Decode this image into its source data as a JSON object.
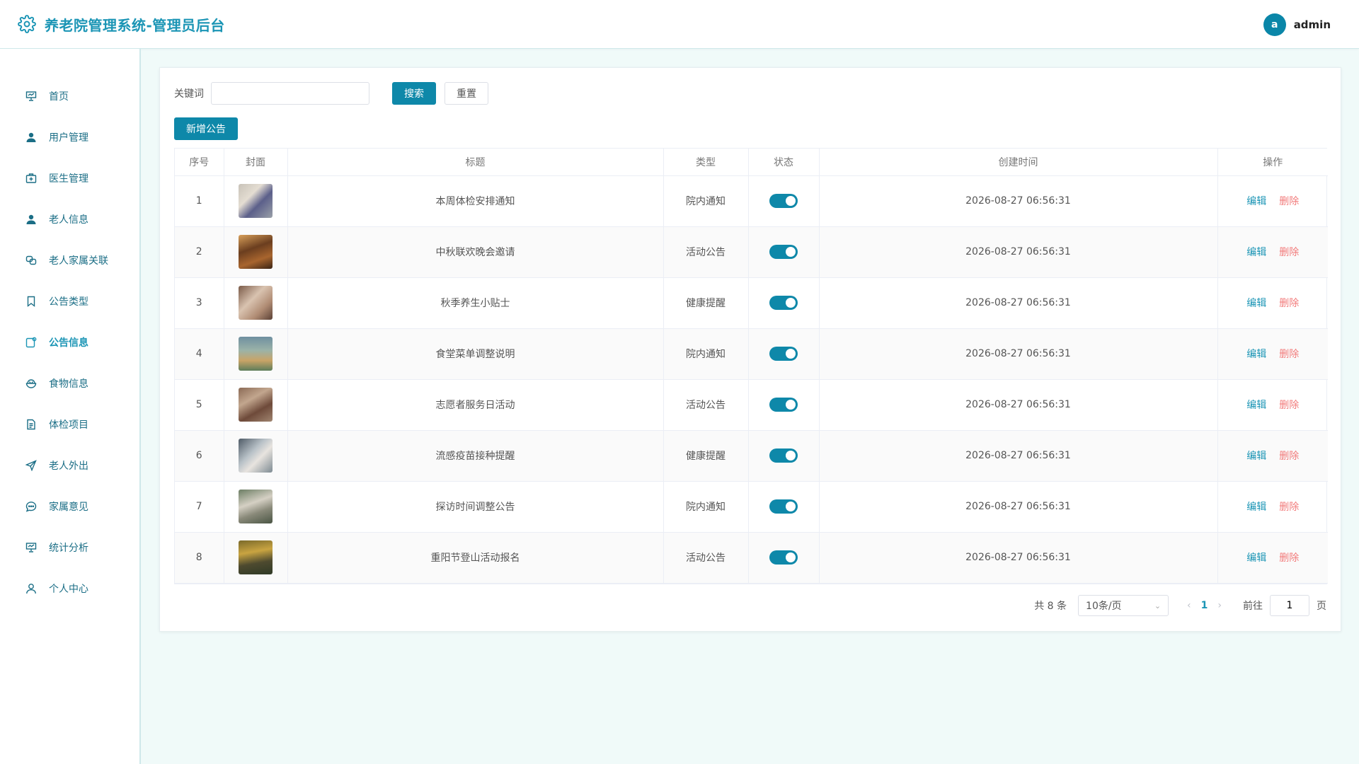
{
  "header": {
    "title": "养老院管理系统-管理员后台",
    "avatar_letter": "a",
    "username": "admin"
  },
  "sidebar": {
    "items": [
      {
        "label": "首页",
        "icon": "presentation-board-icon"
      },
      {
        "label": "用户管理",
        "icon": "user-icon"
      },
      {
        "label": "医生管理",
        "icon": "medical-kit-icon"
      },
      {
        "label": "老人信息",
        "icon": "user-icon"
      },
      {
        "label": "老人家属关联",
        "icon": "link-icon"
      },
      {
        "label": "公告类型",
        "icon": "bookmark-icon"
      },
      {
        "label": "公告信息",
        "icon": "notice-icon",
        "active": true
      },
      {
        "label": "食物信息",
        "icon": "food-bowl-icon"
      },
      {
        "label": "体检项目",
        "icon": "document-icon"
      },
      {
        "label": "老人外出",
        "icon": "send-arrow-icon"
      },
      {
        "label": "家属意见",
        "icon": "chat-bubble-icon"
      },
      {
        "label": "统计分析",
        "icon": "presentation-board-icon"
      },
      {
        "label": "个人中心",
        "icon": "user-outline-icon"
      }
    ],
    "active_color": "#1b95b5"
  },
  "search": {
    "label": "关键词",
    "value": "",
    "search_button": "搜索",
    "reset_button": "重置",
    "add_button": "新增公告"
  },
  "table": {
    "columns": [
      "序号",
      "封面",
      "标题",
      "类型",
      "状态",
      "创建时间",
      "操作"
    ],
    "edit_label": "编辑",
    "delete_label": "删除",
    "rows": [
      {
        "no": "1",
        "title": "本周体检安排通知",
        "type": "院内通知",
        "status": true,
        "created": "2026-08-27 06:56:31"
      },
      {
        "no": "2",
        "title": "中秋联欢晚会邀请",
        "type": "活动公告",
        "status": true,
        "created": "2026-08-27 06:56:31"
      },
      {
        "no": "3",
        "title": "秋季养生小贴士",
        "type": "健康提醒",
        "status": true,
        "created": "2026-08-27 06:56:31"
      },
      {
        "no": "4",
        "title": "食堂菜单调整说明",
        "type": "院内通知",
        "status": true,
        "created": "2026-08-27 06:56:31"
      },
      {
        "no": "5",
        "title": "志愿者服务日活动",
        "type": "活动公告",
        "status": true,
        "created": "2026-08-27 06:56:31"
      },
      {
        "no": "6",
        "title": "流感疫苗接种提醒",
        "type": "健康提醒",
        "status": true,
        "created": "2026-08-27 06:56:31"
      },
      {
        "no": "7",
        "title": "探访时间调整公告",
        "type": "院内通知",
        "status": true,
        "created": "2026-08-27 06:56:31"
      },
      {
        "no": "8",
        "title": "重阳节登山活动报名",
        "type": "活动公告",
        "status": true,
        "created": "2026-08-27 06:56:31"
      }
    ]
  },
  "pagination": {
    "total_text": "共 8 条",
    "page_size": "10条/页",
    "current_page": "1",
    "goto_label": "前往",
    "goto_value": "1",
    "goto_suffix": "页"
  },
  "colors": {
    "primary": "#0e88a9",
    "danger": "#f27b7b",
    "background": "#f0faf9"
  }
}
